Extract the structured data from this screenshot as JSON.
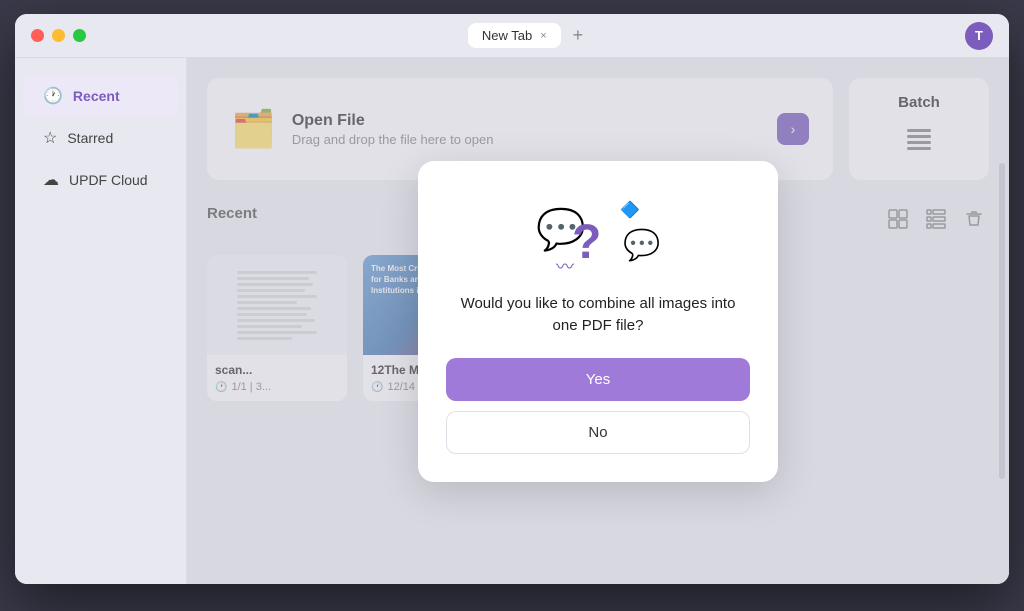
{
  "window": {
    "title": "New Tab",
    "tab_close": "×",
    "tab_add": "+"
  },
  "avatar": {
    "label": "T"
  },
  "sidebar": {
    "items": [
      {
        "id": "recent",
        "label": "Recent",
        "icon": "🕐",
        "active": true
      },
      {
        "id": "starred",
        "label": "Starred",
        "icon": "☆",
        "active": false
      },
      {
        "id": "updf-cloud",
        "label": "UPDF Cloud",
        "icon": "☁",
        "active": false
      }
    ]
  },
  "open_file": {
    "title": "Open File",
    "subtitle": "Drag and drop the file here to open",
    "icon": "🗂"
  },
  "batch": {
    "title": "Batch",
    "icon": "≡"
  },
  "recent": {
    "label": "Recent",
    "files": [
      {
        "name": "scan...",
        "meta": "1/1 | 3...",
        "type": "scan"
      },
      {
        "name": "12The Most Crucial Strategy for Banks",
        "meta": "12/14 | 18 MB",
        "type": "pdf"
      }
    ]
  },
  "dialog": {
    "message": "Would you like to combine all images into one PDF file?",
    "yes_label": "Yes",
    "no_label": "No"
  }
}
